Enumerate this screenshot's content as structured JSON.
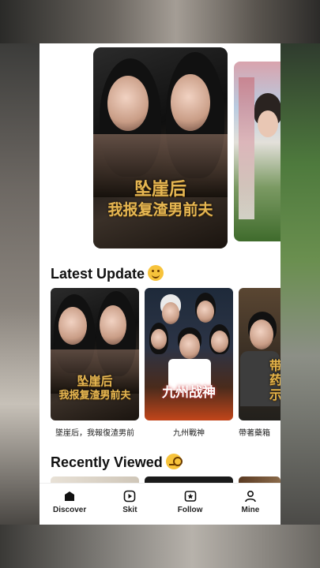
{
  "banner": {
    "main_title_line1": "坠崖后",
    "main_title_line2": "我报复渣男前夫"
  },
  "sections": {
    "latest_update": {
      "title": "Latest Update",
      "icon": "smiling-face-icon"
    },
    "recently_viewed": {
      "title": "Recently Viewed",
      "icon": "face-with-monocle-icon"
    }
  },
  "latest": [
    {
      "caption": "墜崖后，我報復渣男前",
      "poster_title_line1": "坠崖后",
      "poster_title_line2": "我报复渣男前夫"
    },
    {
      "caption": "九州戰神",
      "poster_title": "九州战神"
    },
    {
      "caption": "帶著藥箱",
      "poster_title": "带 药 示"
    }
  ],
  "tabs": [
    {
      "label": "Discover",
      "icon": "home-icon",
      "active": true
    },
    {
      "label": "Skit",
      "icon": "play-icon",
      "active": false
    },
    {
      "label": "Follow",
      "icon": "star-bookmark-icon",
      "active": false
    },
    {
      "label": "Mine",
      "icon": "user-icon",
      "active": false
    }
  ],
  "colors": {
    "accent_gold": "#e5b652",
    "text": "#111111",
    "background": "#ffffff"
  }
}
